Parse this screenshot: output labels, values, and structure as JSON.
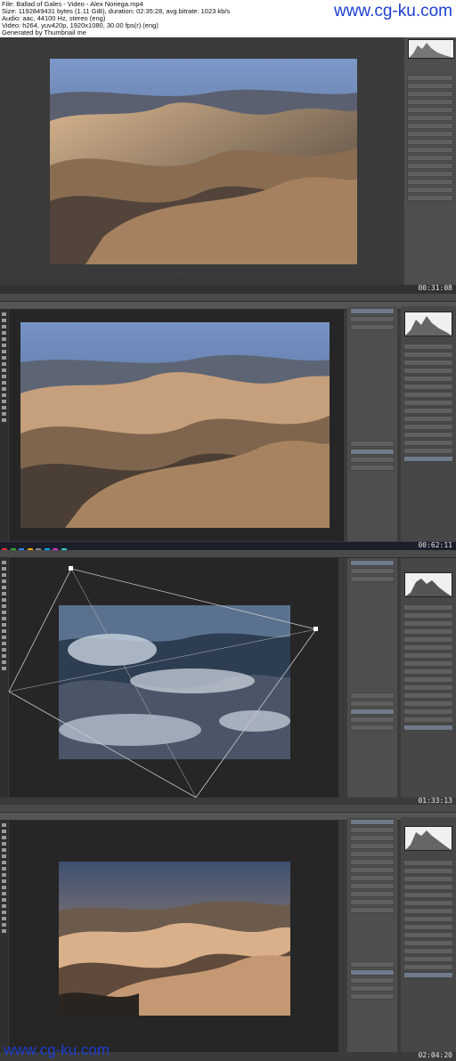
{
  "header": {
    "file_line": "File: Ballad of Gales - Video - Alex Noriega.mp4",
    "size_line": "Size: 1192849431 bytes (1.11 GiB), duration: 02:35:28, avg.bitrate: 1023 kb/s",
    "audio_line": "Audio: aac, 44100 Hz, stereo (eng)",
    "video_line": "Video: h264, yuv420p, 1920x1080, 30.00 fps(r) (eng)",
    "generated_line": "Generated by Thumbnail me"
  },
  "watermark": {
    "top": "www.cg-ku.com",
    "bottom": "www.cg-ku.com"
  },
  "frames": [
    {
      "timestamp": "00:31:08",
      "app": "camera-raw"
    },
    {
      "timestamp": "00:62:11",
      "app": "photoshop"
    },
    {
      "timestamp": "01:33:13",
      "app": "photoshop-transform"
    },
    {
      "timestamp": "02:04:20",
      "app": "photoshop"
    }
  ],
  "colors": {
    "watermark": "#1c3fd0",
    "ui_dark": "#3b3b3b",
    "panel": "#4e4e4e",
    "sand": "#c9a27a",
    "sky": "#4e6a9a"
  }
}
